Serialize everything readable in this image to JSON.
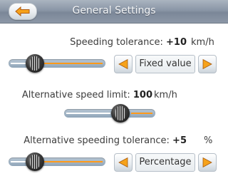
{
  "header": {
    "title": "General Settings",
    "back_icon": "back-arrow-icon"
  },
  "speeding_tolerance": {
    "label": "Speeding tolerance:",
    "value": "+10",
    "unit": "km/h",
    "slider_level": 0.18,
    "mode": "Fixed value"
  },
  "alternative_speed_limit": {
    "label": "Alternative speed limit:",
    "value": "100",
    "unit": "km/h",
    "slider_level": 0.62
  },
  "alternative_speeding_tolerance": {
    "label": "Alternative speeding tolerance:",
    "value": "+5",
    "unit": "%",
    "slider_level": 0.18,
    "mode": "Percentage"
  },
  "colors": {
    "accent_orange": "#ff9a1a",
    "header_blue_gray": "#8a96a6",
    "arrow_yellow": "#f6a21a"
  }
}
